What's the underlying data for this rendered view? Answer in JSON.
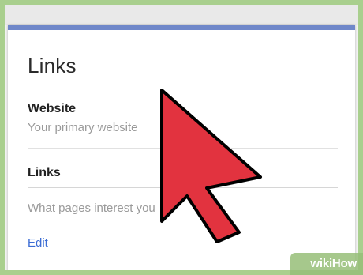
{
  "card": {
    "title": "Links",
    "website_label": "Website",
    "website_placeholder": "Your primary website",
    "links_label": "Links",
    "links_placeholder": "What pages interest you",
    "edit_label": "Edit"
  },
  "cursor": {
    "icon": "mouse-pointer-icon",
    "color": "#e2333f",
    "outline": "#000000"
  },
  "watermark": {
    "text": "wikiHow"
  },
  "colors": {
    "card_border": "#6f87c9",
    "link": "#3b6cd4",
    "background": "#a9cf8e"
  }
}
